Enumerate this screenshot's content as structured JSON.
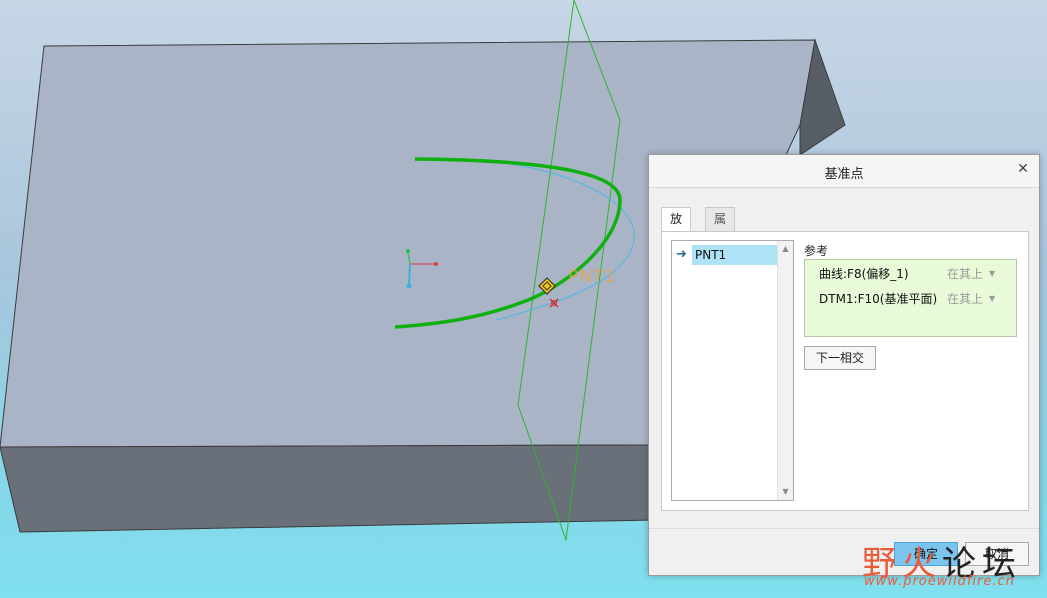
{
  "viewport": {
    "point_label": "PNT1",
    "colors": {
      "top_face": "#a9b4c6",
      "side_face": "#6a707a",
      "end_face": "#575e66",
      "curve": "#10b010",
      "datum": "#2db52d",
      "ellipse": "#4fb8e6"
    }
  },
  "dialog": {
    "title": "基准点",
    "close_icon": "close-icon",
    "tabs": [
      {
        "label": "放置",
        "active": true
      },
      {
        "label": "属性",
        "active": false
      }
    ],
    "points": [
      {
        "label": "PNT1",
        "selected": true
      }
    ],
    "references": {
      "heading": "参考",
      "items": [
        {
          "name": "曲线:F8(偏移_1)",
          "type": "在其上"
        },
        {
          "name": "DTM1:F10(基准平面)",
          "type": "在其上"
        }
      ]
    },
    "next_intersection": "下一相交",
    "ok": "确定",
    "cancel": "取消"
  },
  "watermark": {
    "part1": "野火",
    "part2": "论坛",
    "url": "www.proewildfire.cn"
  }
}
